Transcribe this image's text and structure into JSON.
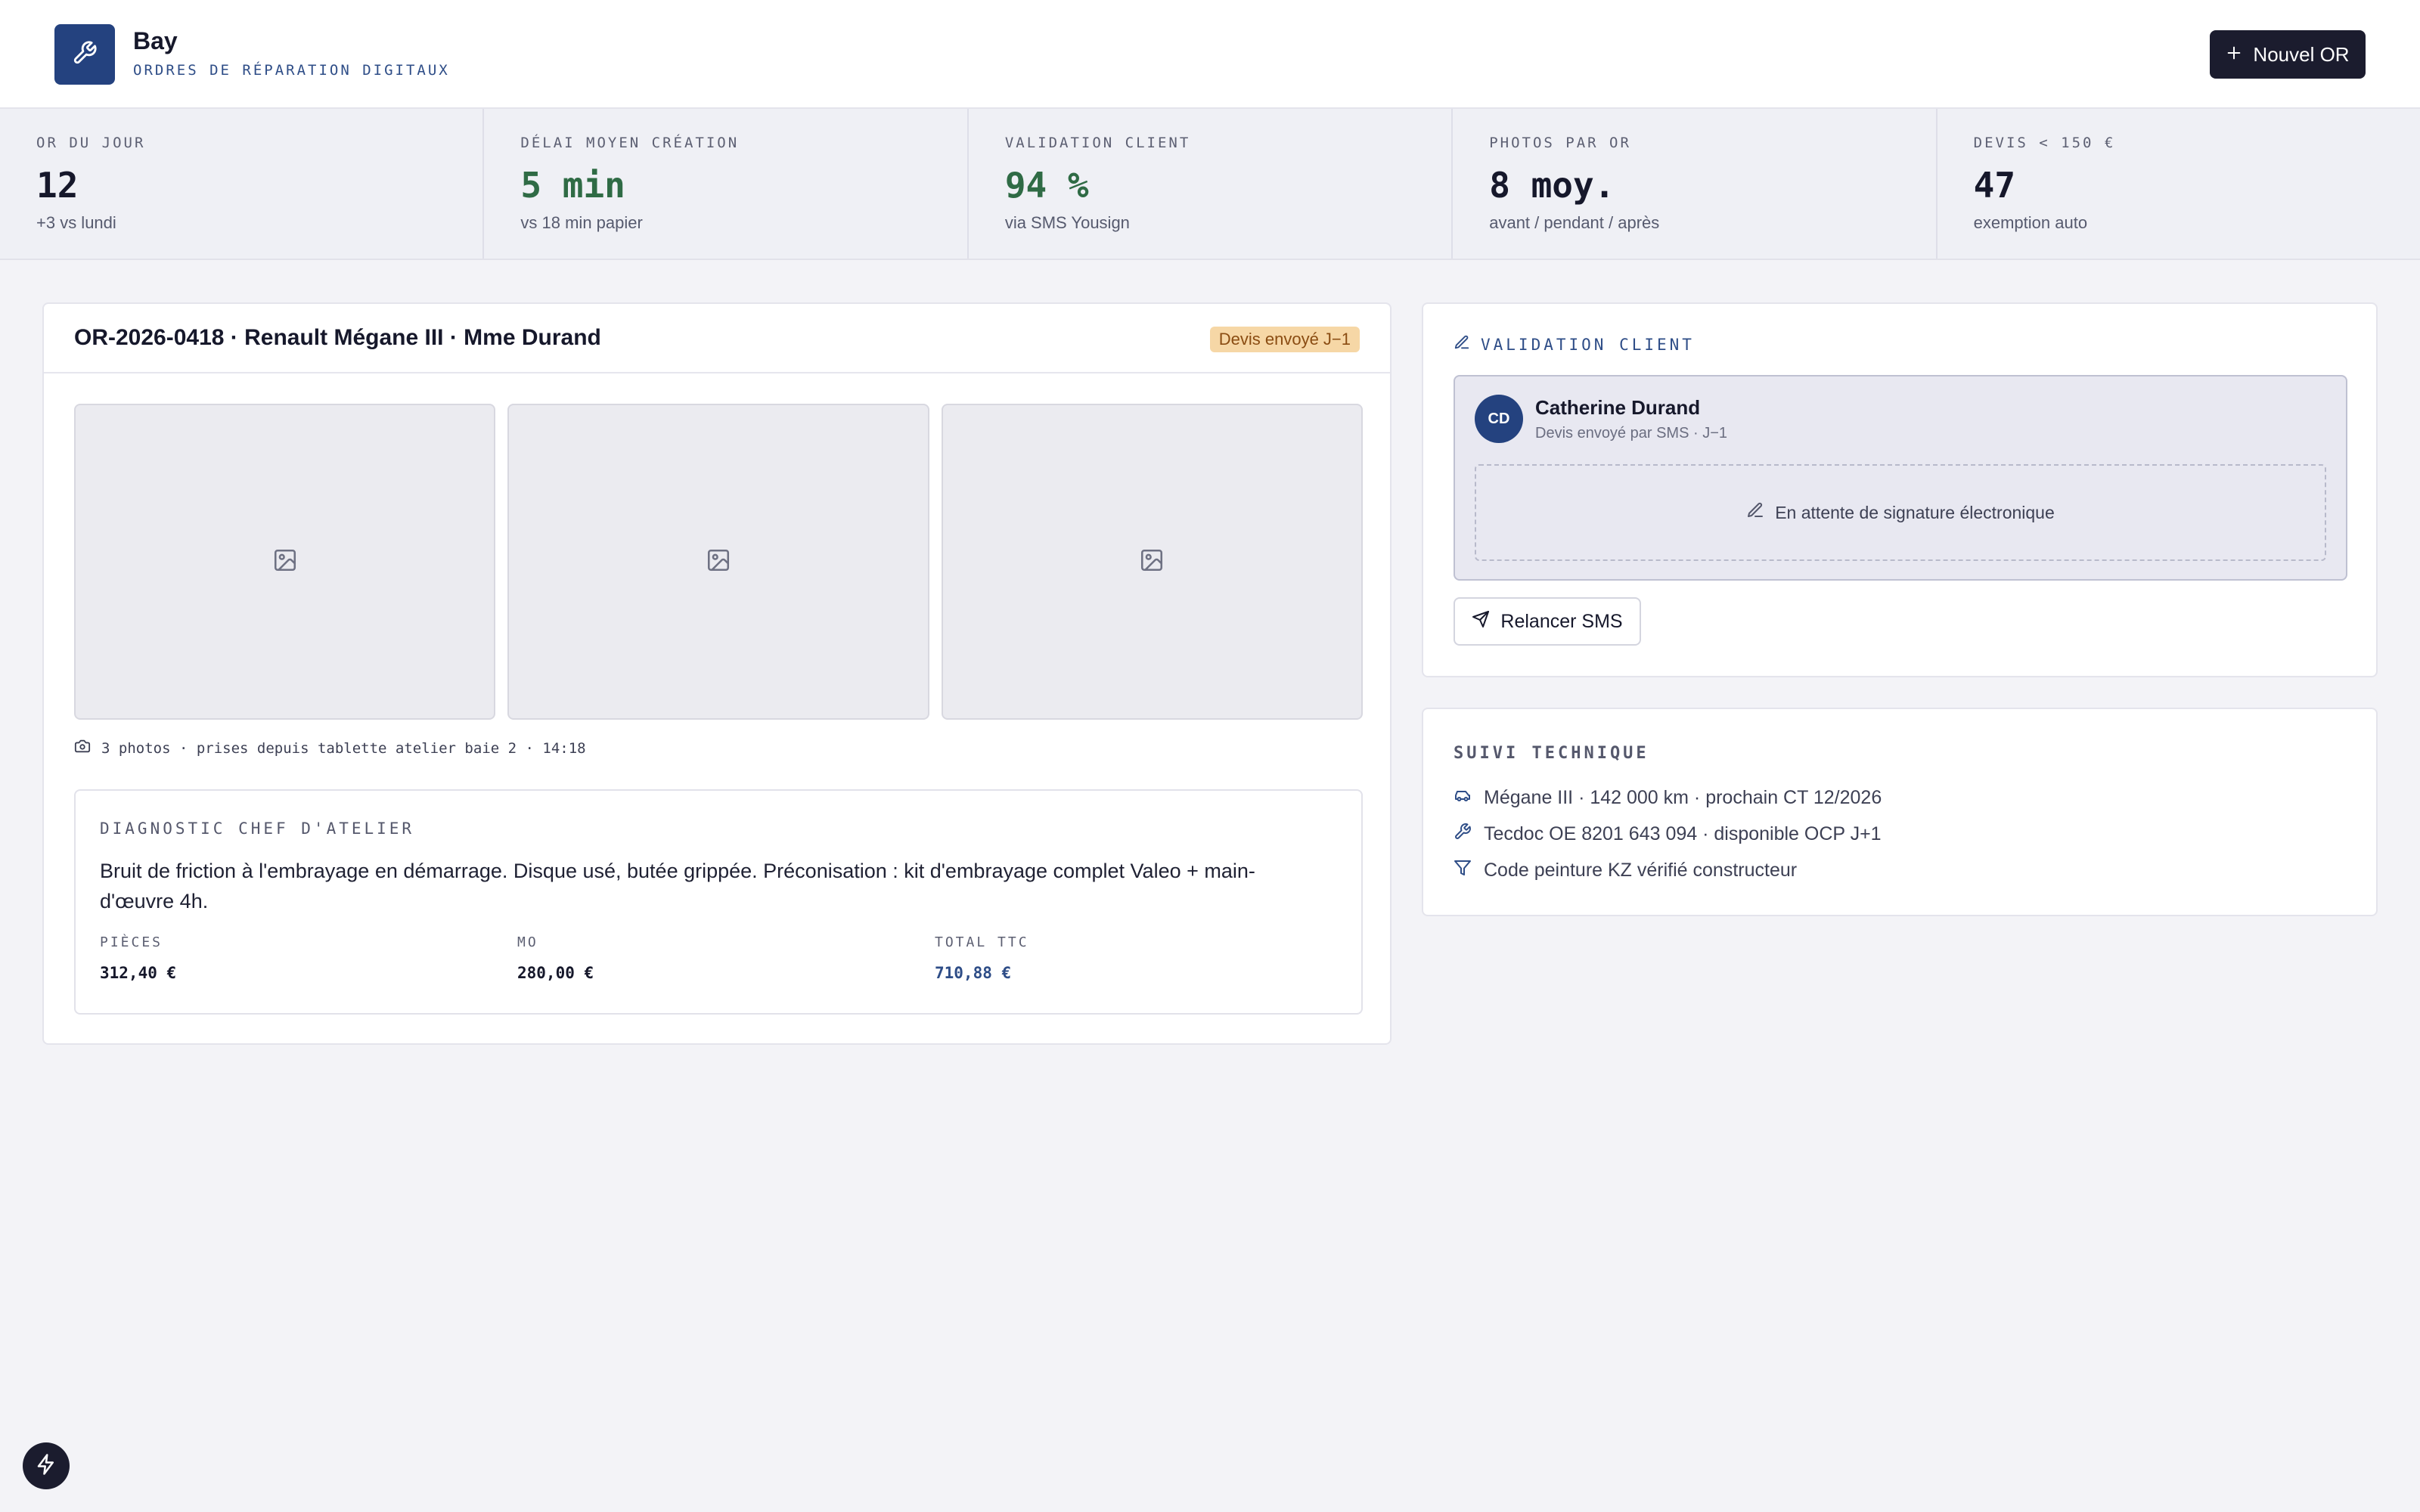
{
  "header": {
    "app_name": "Bay",
    "app_subtitle": "ORDRES DE RÉPARATION DIGITAUX",
    "new_button_label": "Nouvel OR",
    "logo_icon": "wrench-icon"
  },
  "stats": [
    {
      "label": "OR DU JOUR",
      "value": "12",
      "sub": "+3 vs lundi"
    },
    {
      "label": "DÉLAI MOYEN CRÉATION",
      "value": "5 min",
      "sub": "vs 18 min papier"
    },
    {
      "label": "VALIDATION CLIENT",
      "value": "94 %",
      "sub": "via SMS Yousign"
    },
    {
      "label": "PHOTOS PAR OR",
      "value": "8 moy.",
      "sub": "avant / pendant / après"
    },
    {
      "label": "DEVIS < 150 €",
      "value": "47",
      "sub": "exemption auto"
    }
  ],
  "order": {
    "title": "OR-2026-0418 · Renault Mégane III · Mme Durand",
    "status_badge": "Devis envoyé J−1",
    "photo_caption": "3 photos · prises depuis tablette atelier baie 2 · 14:18",
    "diagnostic": {
      "label": "DIAGNOSTIC CHEF D'ATELIER",
      "text": "Bruit de friction à l'embrayage en démarrage. Disque usé, butée grippée. Préconisation : kit d'embrayage complet Valeo + main-d'œuvre 4h.",
      "parts_label": "PIÈCES",
      "parts_value": "312,40 €",
      "labor_label": "MO",
      "labor_value": "280,00 €",
      "total_label": "TOTAL TTC",
      "total_value": "710,88 €"
    }
  },
  "validation": {
    "label": "VALIDATION CLIENT",
    "avatar_initials": "CD",
    "client_name": "Catherine Durand",
    "client_sub": "Devis envoyé par SMS · J−1",
    "signature_status": "En attente de signature électronique",
    "resend_button": "Relancer SMS"
  },
  "suivi": {
    "label": "SUIVI TECHNIQUE",
    "items": [
      {
        "icon": "car-icon",
        "text": "Mégane III · 142 000 km · prochain CT 12/2026"
      },
      {
        "icon": "wrench-icon",
        "text": "Tecdoc OE 8201 643 094 · disponible OCP J+1"
      },
      {
        "icon": "filter-icon",
        "text": "Code peinture KZ vérifié constructeur"
      }
    ]
  },
  "colors": {
    "brand": "#24427f",
    "dark": "#1b1c2e",
    "positive": "#2f6b45",
    "badge_bg": "#f6d7a6"
  }
}
